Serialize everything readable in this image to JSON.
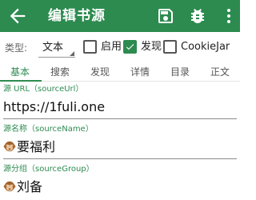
{
  "app_bar": {
    "title": "编辑书源",
    "icons": {
      "back": "arrow-left-icon",
      "save": "save-icon",
      "debug": "bug-icon",
      "more": "more-vertical-icon"
    }
  },
  "options": {
    "type_label": "类型:",
    "type_value": "文本",
    "enable_label": "启用",
    "enable_checked": false,
    "discover_label": "发现",
    "discover_checked": true,
    "cookiejar_label": "CookieJar",
    "cookiejar_checked": false
  },
  "tabs": [
    {
      "label": "基本",
      "active": true
    },
    {
      "label": "搜索",
      "active": false
    },
    {
      "label": "发现",
      "active": false
    },
    {
      "label": "详情",
      "active": false
    },
    {
      "label": "目录",
      "active": false
    },
    {
      "label": "正文",
      "active": false
    }
  ],
  "fields": [
    {
      "label": "源 URL（sourceUrl）",
      "value": "https://1fuli.one",
      "icon": null
    },
    {
      "label": "源名称（sourceName）",
      "value": "要福利",
      "icon": "monkey-emoji-icon"
    },
    {
      "label": "源分组（sourceGroup）",
      "value": "刘备",
      "icon": "monkey-emoji-icon"
    }
  ],
  "colors": {
    "primary": "#2d8b50",
    "text": "#212121",
    "secondary_text": "#666666"
  }
}
